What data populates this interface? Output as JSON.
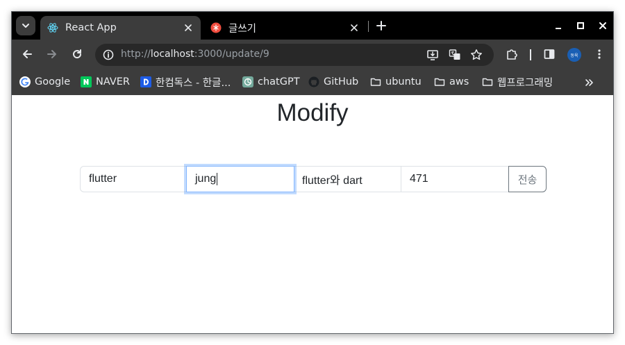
{
  "browser": {
    "tabs": [
      {
        "title": "React App",
        "active": true,
        "icon": "react-icon"
      },
      {
        "title": "글쓰기",
        "active": false,
        "icon": "pinwheel-icon"
      }
    ],
    "address": {
      "scheme": "http://",
      "host": "localhost",
      "rest": ":3000/update/9"
    },
    "profile_label": "동욱",
    "bookmarks": [
      {
        "label": "Google",
        "icon": "google-icon"
      },
      {
        "label": "NAVER",
        "icon": "naver-icon"
      },
      {
        "label": "한컴독스 - 한글...",
        "icon": "hancom-docs-icon"
      },
      {
        "label": "chatGPT",
        "icon": "chatgpt-icon"
      },
      {
        "label": "GitHub",
        "icon": "github-icon"
      },
      {
        "label": "ubuntu",
        "icon": "folder-icon"
      },
      {
        "label": "aws",
        "icon": "folder-icon"
      },
      {
        "label": "웹프로그래밍",
        "icon": "folder-icon"
      }
    ],
    "colors": {
      "tabstrip": "#000000",
      "toolbar": "#3c3c3c",
      "omnibox": "#282828",
      "focus_ring": "#86b7fe"
    }
  },
  "page": {
    "title": "Modify",
    "form": {
      "fields": [
        {
          "value": "flutter"
        },
        {
          "value": "jung"
        },
        {
          "value": "flutter와 dart"
        },
        {
          "value": "471"
        }
      ],
      "submit_label": "전송"
    }
  }
}
